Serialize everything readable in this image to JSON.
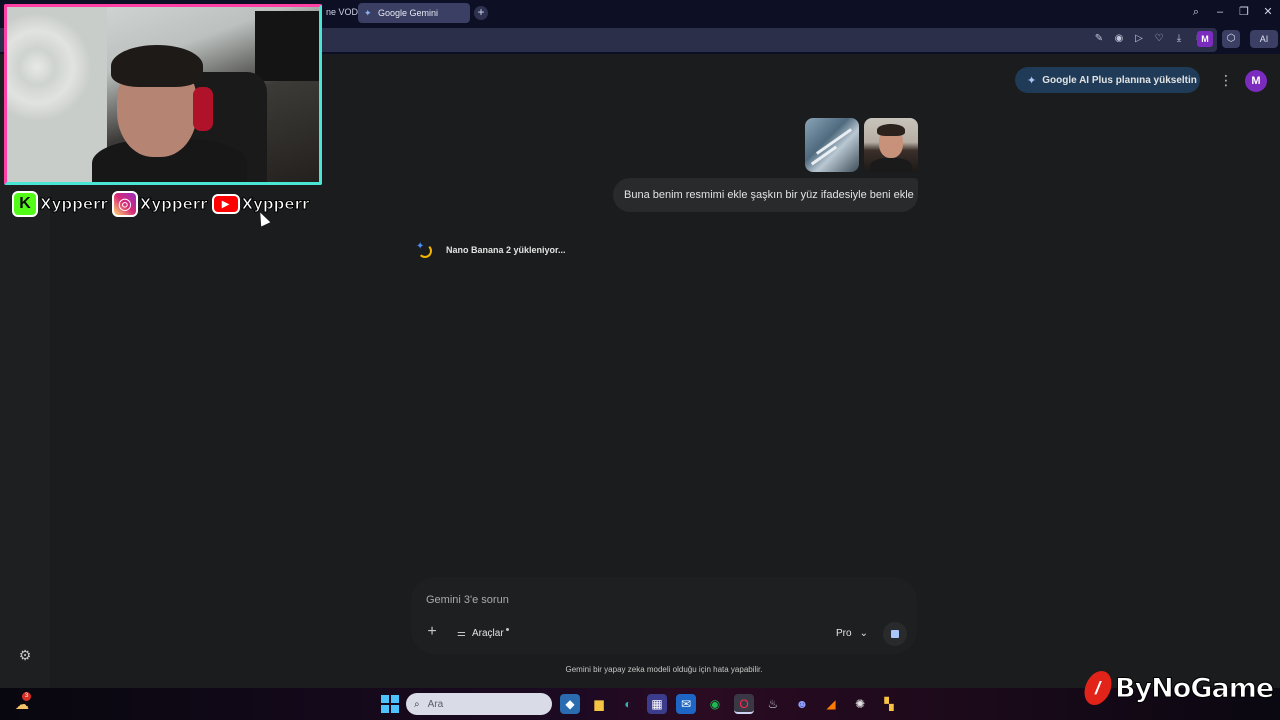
{
  "browser": {
    "tabs": [
      {
        "label": "ne VOD",
        "active": false
      },
      {
        "label": "Google Gemini",
        "active": true
      }
    ],
    "toolbar": {
      "avatar_letter": "M",
      "ai_label": "AI"
    }
  },
  "header": {
    "upgrade_label": "Google AI Plus planına yükseltin",
    "avatar_letter": "M"
  },
  "conversation": {
    "user_message": "Buna benim resmimi ekle şaşkın bir yüz ifadesiyle beni ekle",
    "loading_text": "Nano Banana 2 yükleniyor..."
  },
  "composer": {
    "placeholder": "Gemini 3'e sorun",
    "tools_label": "Araçlar",
    "model_label": "Pro"
  },
  "disclaimer": "Gemini bir yapay zeka modeli olduğu için hata yapabilir.",
  "overlay": {
    "socials": [
      {
        "platform": "kick",
        "handle": "Xypperr"
      },
      {
        "platform": "instagram",
        "handle": "Xypperr"
      },
      {
        "platform": "youtube",
        "handle": "Xypperr"
      }
    ],
    "watermark": "ByNoGame"
  },
  "taskbar": {
    "search_placeholder": "Ara",
    "notification_count": "3"
  },
  "colors": {
    "accent": "#a8c7fa",
    "upgrade_bg": "#1f3b57",
    "avatar": "#7b2cbf"
  }
}
